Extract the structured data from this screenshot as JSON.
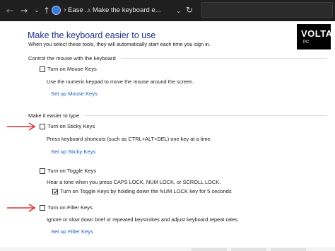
{
  "address_bar": {
    "nav_back": "←",
    "nav_forward": "→",
    "nav_dropdown": "⌄",
    "nav_up": "↑",
    "crumb_sep": "›",
    "crumb_1": "Ease ...",
    "crumb_2": "Make the keyboard e...",
    "crumb_dropdown": "⌄",
    "refresh": "↻",
    "search_value": ""
  },
  "page": {
    "title": "Make the keyboard easier to use",
    "subtitle": "When you select these tools, they will automatically start each time you sign in."
  },
  "mouse_section": {
    "heading": "Control the mouse with the keyboard",
    "mouse_keys_label": "Turn on Mouse Keys",
    "mouse_keys_checked": false,
    "mouse_keys_desc": "Use the numeric keypad to move the mouse around the screen.",
    "setup_link": "Set up Mouse Keys"
  },
  "type_section": {
    "heading": "Make it easier to type",
    "sticky_label": "Turn on Sticky Keys",
    "sticky_checked": false,
    "sticky_desc": "Press keyboard shortcuts (such as CTRL+ALT+DEL) one key at a time.",
    "sticky_link": "Set up Sticky Keys",
    "toggle_label": "Turn on Toggle Keys",
    "toggle_checked": false,
    "toggle_desc": "Hear a tone when you press CAPS LOCK, NUM LOCK, or SCROLL LOCK.",
    "toggle_sub_label": "Turn on Toggle Keys by holding down the NUM LOCK key for 5 seconds",
    "toggle_sub_checked": true,
    "filter_label": "Turn on Filter Keys",
    "filter_checked": false,
    "filter_desc": "Ignore or slow down brief or repeated keystrokes and adjust keyboard repeat rates.",
    "filter_link": "Set up Filter Keys"
  },
  "watermark": {
    "text": "VOLTA",
    "sub": "PC"
  },
  "colors": {
    "title": "#1e3287",
    "link": "#1a5fb4",
    "arrow": "#e03030",
    "toolbar_bg": "#1f1f1f"
  }
}
